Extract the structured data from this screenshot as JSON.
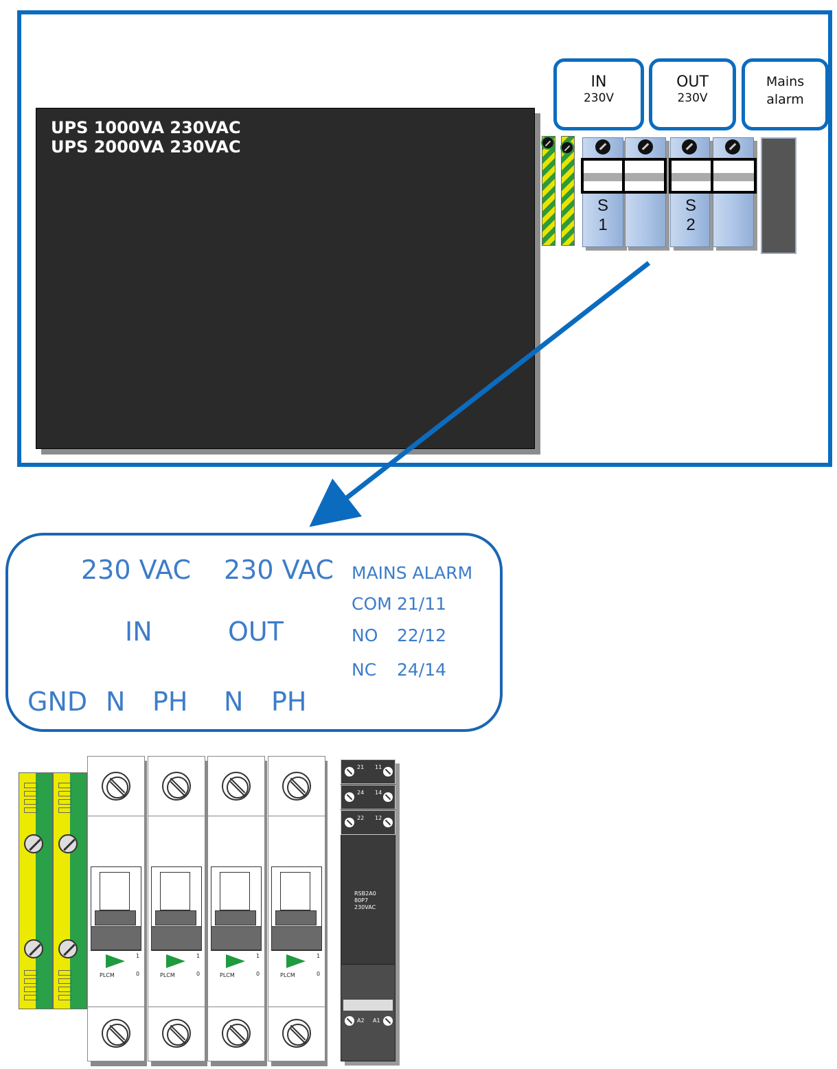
{
  "enclosure": {
    "ups_lines": [
      "UPS 1000VA 230VAC",
      "UPS 2000VA 230VAC"
    ],
    "labels": [
      {
        "main": "IN",
        "sub": "230V"
      },
      {
        "main": "OUT",
        "sub": "230V"
      },
      {
        "main": "Mains",
        "sub": "alarm"
      }
    ],
    "terminals": [
      "S\n1",
      "S\n2"
    ]
  },
  "legend": {
    "in_voltage": "230 VAC",
    "out_voltage": "230 VAC",
    "in_label": "IN",
    "out_label": "OUT",
    "alarm_title": "MAINS ALARM",
    "alarm_rows": [
      {
        "name": "COM",
        "value": "21/11"
      },
      {
        "name": "NO",
        "value": "22/12"
      },
      {
        "name": "NC",
        "value": "24/14"
      }
    ],
    "terminals": [
      "GND",
      "N",
      "PH",
      "N",
      "PH"
    ]
  },
  "detail": {
    "breaker_brand": "PLCM",
    "breaker_on": "1",
    "breaker_off": "0",
    "relay_top_pairs": [
      [
        "21",
        "11"
      ],
      [
        "24",
        "14"
      ],
      [
        "22",
        "12"
      ]
    ],
    "relay_model": [
      "RSB2A0",
      "80P7",
      "230VAC"
    ],
    "relay_bottom": [
      "A2",
      "A1"
    ]
  },
  "colors": {
    "accent_blue": "#0b6cbf",
    "legend_text": "#3d7cc9",
    "ups_body": "#2a2a2a",
    "ground_yellow": "#ecea00",
    "ground_green": "#2aa048"
  }
}
